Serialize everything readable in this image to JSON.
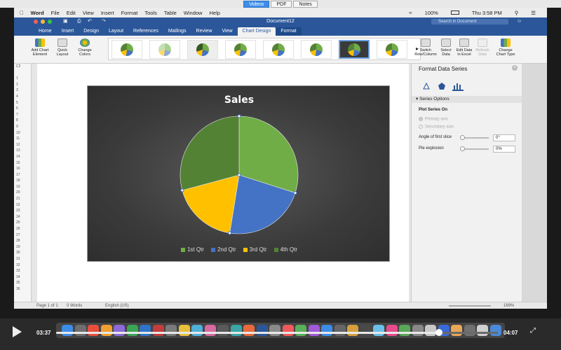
{
  "viewer": {
    "tabs": [
      "Videos",
      "PDF",
      "Notes"
    ],
    "active": "Videos"
  },
  "menubar": {
    "app": "Word",
    "items": [
      "File",
      "Edit",
      "View",
      "Insert",
      "Format",
      "Tools",
      "Table",
      "Window",
      "Help"
    ],
    "battery": "100%",
    "clock": "Thu 3:58 PM"
  },
  "window": {
    "title": "Document12",
    "search_placeholder": "Search in Document"
  },
  "ribbon": {
    "tabs": [
      "Home",
      "Insert",
      "Design",
      "Layout",
      "References",
      "Mailings",
      "Review",
      "View",
      "Chart Design",
      "Format"
    ],
    "active_tab": "Chart Design",
    "left_buttons": [
      {
        "label1": "Add Chart",
        "label2": "Element"
      },
      {
        "label1": "Quick",
        "label2": "Layout"
      },
      {
        "label1": "Change",
        "label2": "Colors"
      }
    ],
    "right_buttons": [
      {
        "label1": "Switch",
        "label2": "Row/Column"
      },
      {
        "label1": "Select",
        "label2": "Data"
      },
      {
        "label1": "Edit Data",
        "label2": "in Excel"
      },
      {
        "label1": "Refresh",
        "label2": "Data"
      },
      {
        "label1": "Change",
        "label2": "Chart Type"
      }
    ]
  },
  "excel_rows": [
    "C2",
    "",
    "1",
    "2",
    "3",
    "4",
    "5",
    "6",
    "7",
    "8",
    "9",
    "10",
    "11",
    "12",
    "13",
    "14",
    "15",
    "16",
    "17",
    "18",
    "19",
    "20",
    "21",
    "22",
    "23",
    "24",
    "25",
    "26",
    "27",
    "28",
    "29",
    "30",
    "31",
    "32",
    "33",
    "34",
    "35",
    "36"
  ],
  "chart_data": {
    "type": "pie",
    "title": "Sales",
    "categories": [
      "1st Qtr",
      "2nd Qtr",
      "3rd Qtr",
      "4th Qtr"
    ],
    "values": [
      8.2,
      6.2,
      5.0,
      8.0
    ],
    "colors": [
      "#70ad47",
      "#4472c4",
      "#ffc000",
      "#548235"
    ],
    "legend": "bottom"
  },
  "panel": {
    "title": "Format Data Series",
    "section": "Series Options",
    "plot_series_on": "Plot Series On",
    "primary_axis": "Primary axis",
    "secondary_axis": "Secondary axis",
    "angle_label": "Angle of first slice",
    "angle_value": "0°",
    "explosion_label": "Pie explosion",
    "explosion_value": "0%"
  },
  "statusbar": {
    "page": "Page 1 of 1",
    "words": "0 Words",
    "lang": "English (US)",
    "zoom": "189%"
  },
  "player": {
    "current": "03:37",
    "remaining": "04:07",
    "progress": 0.867
  }
}
